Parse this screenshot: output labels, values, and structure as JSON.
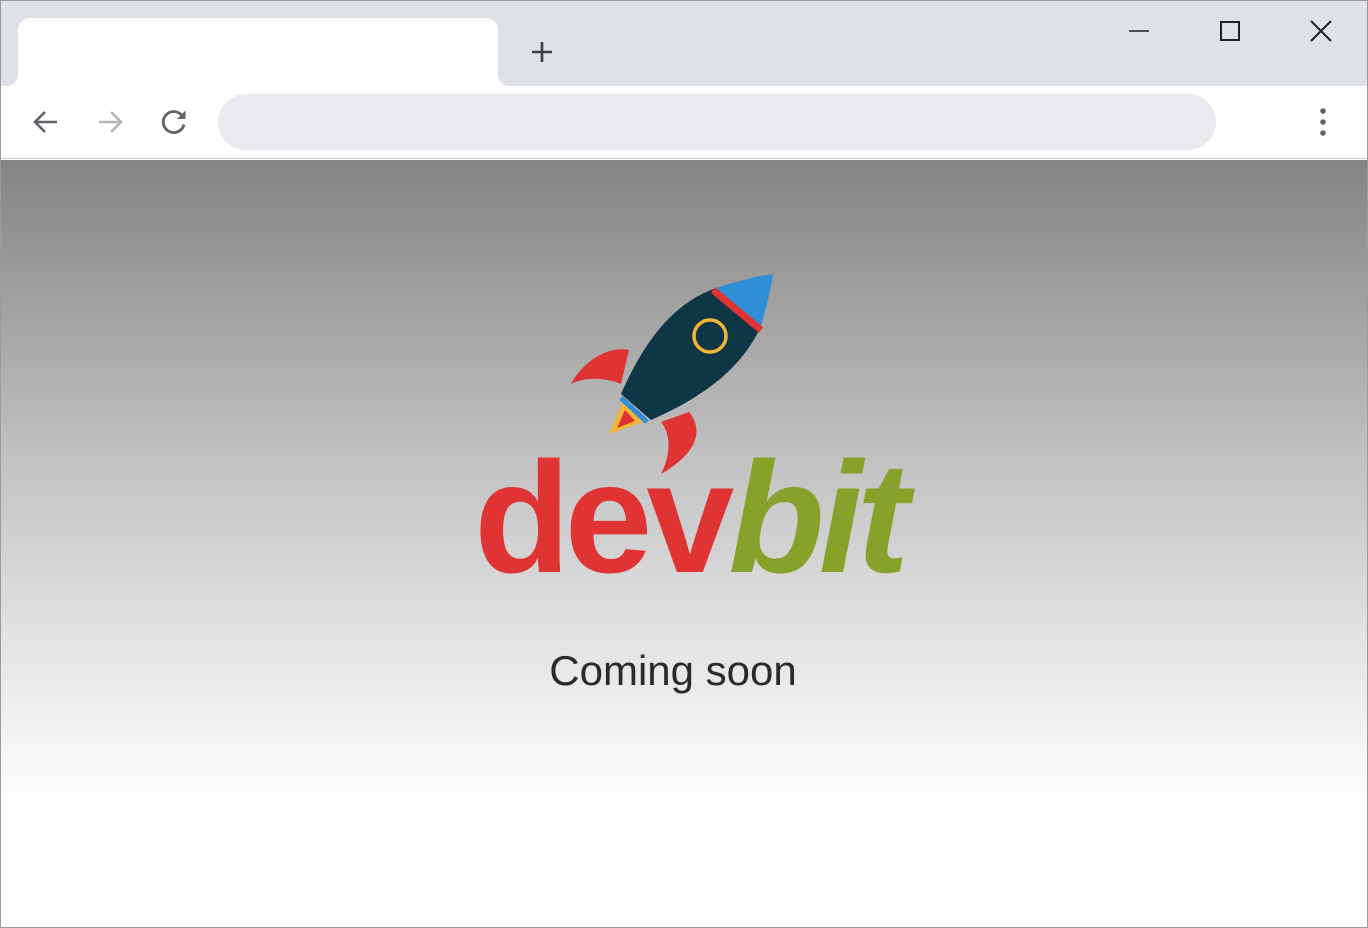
{
  "browser": {
    "tab": {
      "title": ""
    },
    "new_tab_icon": "plus-icon",
    "window_controls": [
      "minimize-icon",
      "maximize-icon",
      "close-icon"
    ],
    "toolbar": {
      "back_icon": "arrow-left-icon",
      "forward_icon": "arrow-right-icon",
      "reload_icon": "reload-icon",
      "address": {
        "value": "",
        "placeholder": ""
      },
      "menu_icon": "vertical-dots-icon"
    }
  },
  "page": {
    "logo": {
      "part1": "dev",
      "part2": "bit",
      "icon": "rocket-icon"
    },
    "tagline": "Coming soon"
  },
  "colors": {
    "logo_dev": "#e03333",
    "logo_bit": "#86a22a",
    "rocket_body": "#0e3645",
    "rocket_nose": "#2f8fd6",
    "rocket_fins": "#e03333",
    "rocket_window_ring": "#f2b632",
    "flame": "#f2b632"
  }
}
